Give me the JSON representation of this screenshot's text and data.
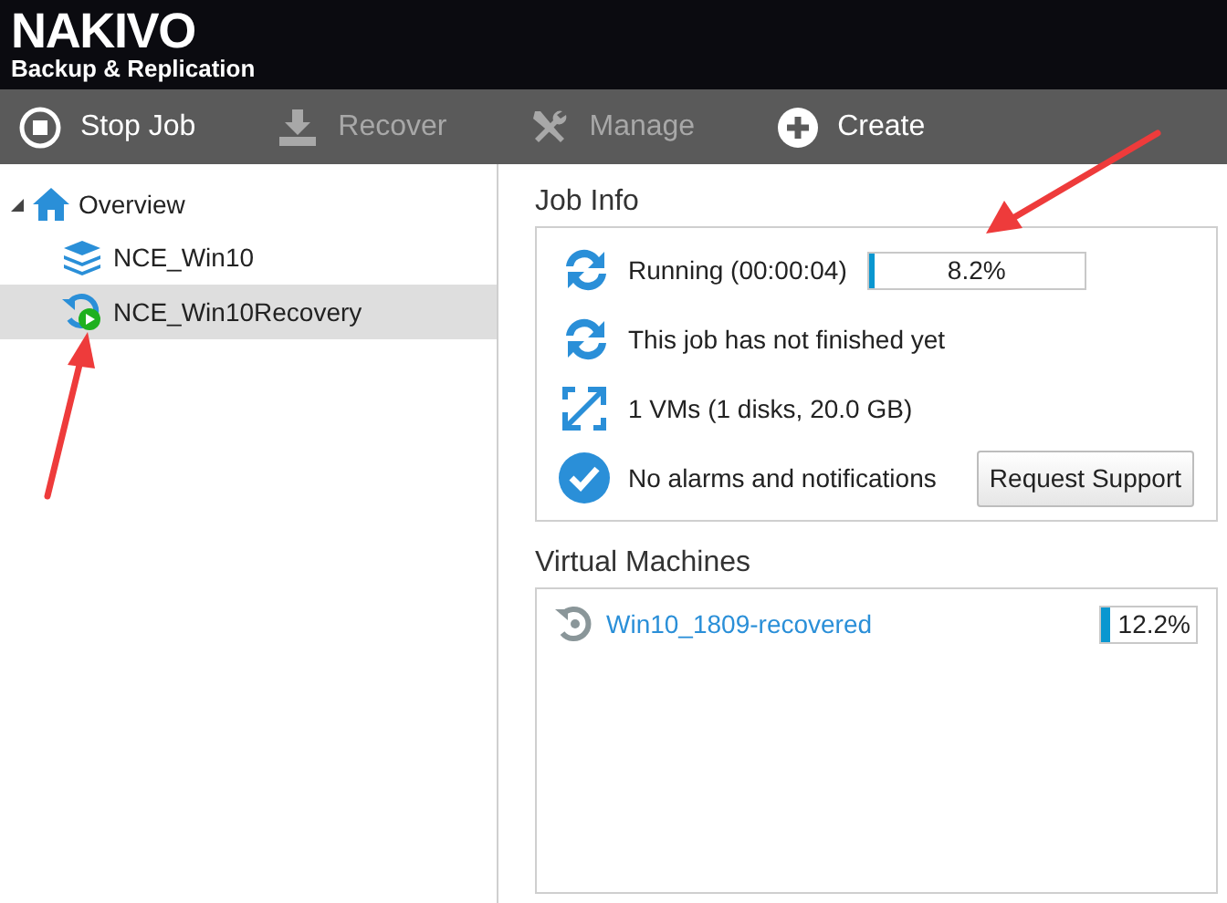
{
  "header": {
    "logo": "NAKIVO",
    "subtitle": "Backup & Replication"
  },
  "toolbar": [
    {
      "kind": "stop",
      "label": "Stop Job",
      "disabled": false
    },
    {
      "kind": "recover",
      "label": "Recover",
      "disabled": true
    },
    {
      "kind": "manage",
      "label": "Manage",
      "disabled": true
    },
    {
      "kind": "create",
      "label": "Create",
      "disabled": false
    }
  ],
  "tree": {
    "label": "Overview",
    "expanded": true,
    "selected": false,
    "children": [
      {
        "kind": "backup",
        "label": "NCE_Win10",
        "selected": false
      },
      {
        "kind": "recovery",
        "label": "NCE_Win10Recovery",
        "selected": true
      }
    ]
  },
  "job_info": {
    "title": "Job Info",
    "rows": [
      {
        "kind": "running",
        "text": "Running (00:00:04)",
        "progress": {
          "level": 0.025,
          "reading": "8.2%"
        }
      },
      {
        "kind": "finished",
        "text": "This job has not finished yet"
      },
      {
        "kind": "vms",
        "text": "1 VMs (1 disks, 20.0 GB)"
      },
      {
        "kind": "alarms",
        "text": "No alarms and notifications",
        "button": "Request Support"
      }
    ]
  },
  "virtual_machines": {
    "title": "Virtual Machines",
    "items": [
      {
        "name": "Win10_1809-recovered",
        "level": 0.1,
        "reading": "12.2%"
      }
    ]
  },
  "annotations": [
    {
      "kind": "arrow"
    },
    {
      "kind": "arrow"
    }
  ]
}
